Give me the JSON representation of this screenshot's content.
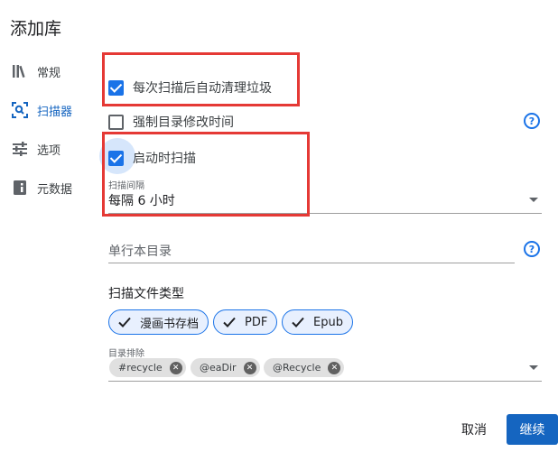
{
  "dialog": {
    "title": "添加库"
  },
  "sidebar": {
    "items": [
      {
        "label": "常规",
        "icon": "library-books-icon"
      },
      {
        "label": "扫描器",
        "icon": "scan-search-icon",
        "active": true
      },
      {
        "label": "选项",
        "icon": "tune-sliders-icon"
      },
      {
        "label": "元数据",
        "icon": "book-info-icon"
      }
    ]
  },
  "scanner": {
    "auto_clean": {
      "label": "每次扫描后自动清理垃圾",
      "checked": true
    },
    "force_modtime": {
      "label": "强制目录修改时间",
      "checked": false
    },
    "scan_on_start": {
      "label": "启动时扫描",
      "checked": true
    },
    "interval": {
      "label": "扫描间隔",
      "value": "每隔 6 小时"
    },
    "oneshot": {
      "placeholder": "单行本目录"
    },
    "file_types": {
      "title": "扫描文件类型",
      "chips": [
        "漫画书存档",
        "PDF",
        "Epub"
      ]
    },
    "exclusions": {
      "label": "目录排除",
      "tags": [
        "#recycle",
        "@eaDir",
        "@Recycle"
      ]
    }
  },
  "actions": {
    "cancel": "取消",
    "continue": "继续"
  },
  "colors": {
    "accent": "#1a73e8",
    "primary_button": "#1565c0",
    "highlight": "#e53935"
  }
}
